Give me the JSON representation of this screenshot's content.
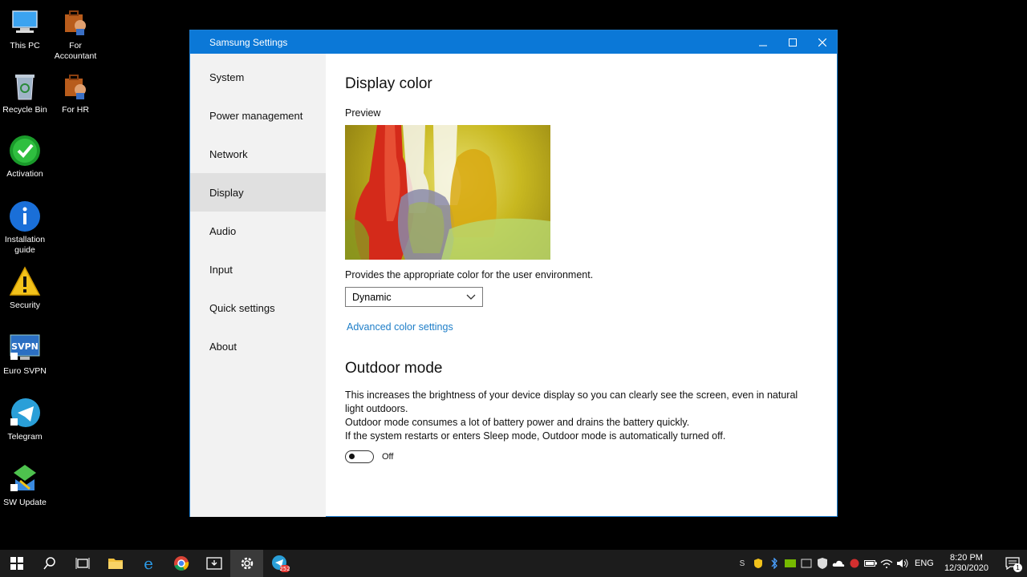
{
  "desktop": {
    "icons": [
      {
        "label": "This PC"
      },
      {
        "label": "For Accountant"
      },
      {
        "label": "Recycle Bin"
      },
      {
        "label": "For HR"
      },
      {
        "label": "Activation"
      },
      {
        "label": "Installation guide"
      },
      {
        "label": "Security"
      },
      {
        "label": "Euro SVPN"
      },
      {
        "label": "Telegram"
      },
      {
        "label": "SW Update"
      }
    ]
  },
  "window": {
    "title": "Samsung Settings",
    "sidebar": {
      "items": [
        "System",
        "Power management",
        "Network",
        "Display",
        "Audio",
        "Input",
        "Quick settings",
        "About"
      ],
      "active": "Display"
    },
    "display_color": {
      "heading": "Display color",
      "preview_label": "Preview",
      "description": "Provides the appropriate color for the user environment.",
      "mode_select": "Dynamic",
      "advanced_link": "Advanced color settings"
    },
    "outdoor_mode": {
      "heading": "Outdoor mode",
      "line1": "This increases the brightness of your device display so you can clearly see the screen, even in natural light outdoors.",
      "line2": "Outdoor mode consumes a lot of battery power and drains the battery quickly.",
      "line3": "If the system restarts or enters Sleep mode, Outdoor mode is automatically turned off.",
      "toggle_state": "Off"
    }
  },
  "taskbar": {
    "telegram_badge": "252",
    "language": "ENG",
    "time": "8:20 PM",
    "date": "12/30/2020",
    "notification_count": "1"
  },
  "colors": {
    "accent": "#0b78d7",
    "link": "#1e7ec8"
  }
}
